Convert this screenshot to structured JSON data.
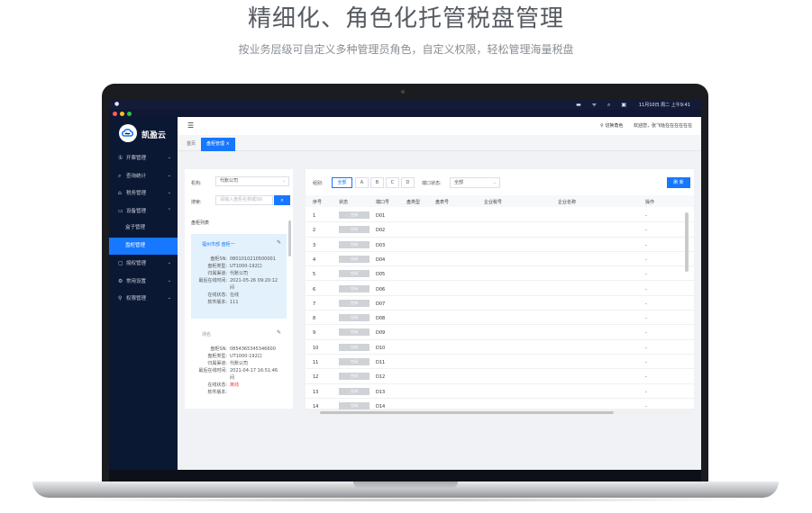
{
  "headline": "精细化、角色化托管税盘管理",
  "subline": "按业务层级可自定义多种管理员角色，自定义权限，轻松管理海量税盘",
  "macbar": {
    "apple": "",
    "icons": "▬ ᯤ ⌕ ▣",
    "datetime": "11月10日 周二 上午9:41"
  },
  "app": {
    "name": "凯盈云",
    "brand_color": "#1677ff",
    "sidebar_color": "#0b1833"
  },
  "sidebar": {
    "items": [
      {
        "label": "开票管理",
        "icon": "①",
        "chev": "⌄"
      },
      {
        "label": "查询统计",
        "icon": "⌕",
        "chev": "⌄"
      },
      {
        "label": "税务管理",
        "icon": "⌂",
        "chev": "⌄"
      },
      {
        "label": "设备管理",
        "icon": "▭",
        "chev": "⌃"
      },
      {
        "label": "盒子管理",
        "icon": "",
        "chev": ""
      },
      {
        "label": "盘柜管理",
        "icon": "",
        "chev": ""
      },
      {
        "label": "授权管理",
        "icon": "▢",
        "chev": "⌄"
      },
      {
        "label": "常用设置",
        "icon": "⚙",
        "chev": "⌄"
      },
      {
        "label": "权限管理",
        "icon": "⚲",
        "chev": "⌄"
      }
    ]
  },
  "topbar": {
    "menu_icon": "☰",
    "switch_role": "切换角色",
    "welcome": "欢迎您，张飞哒在在在在在在"
  },
  "tabs": {
    "home": "首页",
    "current": "盘柜管理",
    "close": "×"
  },
  "filter": {
    "org_label": "机构:",
    "org_value": "代账公司",
    "search_label": "搜索:",
    "search_placeholder": "请输入盘柜名称或SN",
    "search_icon": "⌕"
  },
  "cabinet_list": {
    "title": "盘柜列表",
    "edit_icon": "✎",
    "fields": {
      "sn": "盘柜SN:",
      "type": "盘柜类型:",
      "channel": "归属渠道:",
      "last_online": "最后在线时间:",
      "status": "在线状态:",
      "version": "软件版本:"
    },
    "cards": [
      {
        "title": "福州市部 盘柜一",
        "sn": "0801010210500001",
        "type": "UT1000-192口",
        "channel": "代账公司",
        "last_online": "2021-05-26 09:20:12",
        "last_online_2": "间",
        "status": "在线",
        "version": "111"
      },
      {
        "title": "测名",
        "sn": "0854365345346600",
        "type": "UT1000-192口",
        "channel": "代账公司",
        "last_online": "2021-04-17 16:51:46",
        "last_online_2": "间",
        "status": "离线",
        "version": ""
      }
    ]
  },
  "table": {
    "group_label": "组别:",
    "groups": [
      "全部",
      "A",
      "B",
      "C",
      "D"
    ],
    "port_status_label": "端口状态:",
    "port_status_value": "全部",
    "refresh_label": "刷 新",
    "columns": [
      "序号",
      "状态",
      "端口号",
      "盘类型",
      "盘表号",
      "企业税号",
      "企业名称",
      "操作"
    ],
    "status_pill": "空闲",
    "action_placeholder": "-",
    "rows": [
      {
        "no": "1",
        "port": "D01"
      },
      {
        "no": "2",
        "port": "D02"
      },
      {
        "no": "3",
        "port": "D03"
      },
      {
        "no": "4",
        "port": "D04"
      },
      {
        "no": "5",
        "port": "D05"
      },
      {
        "no": "6",
        "port": "D06"
      },
      {
        "no": "7",
        "port": "D07"
      },
      {
        "no": "8",
        "port": "D08"
      },
      {
        "no": "9",
        "port": "D09"
      },
      {
        "no": "10",
        "port": "D10"
      },
      {
        "no": "11",
        "port": "D11"
      },
      {
        "no": "12",
        "port": "D12"
      },
      {
        "no": "13",
        "port": "D13"
      },
      {
        "no": "14",
        "port": "D14"
      }
    ]
  }
}
